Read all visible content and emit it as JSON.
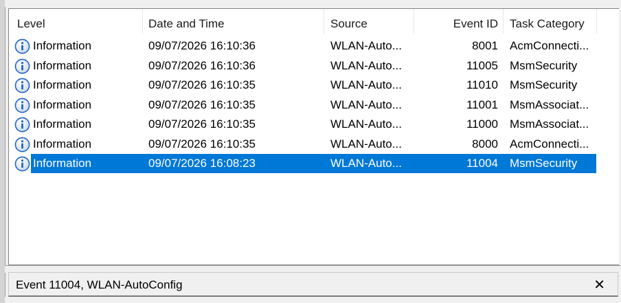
{
  "columns": {
    "level": "Level",
    "date": "Date and Time",
    "source": "Source",
    "event_id": "Event ID",
    "task": "Task Category"
  },
  "rows": [
    {
      "level": "Information",
      "date": "09/07/2026 16:10:36",
      "source": "WLAN-Auto...",
      "event_id": "8001",
      "task": "AcmConnecti..."
    },
    {
      "level": "Information",
      "date": "09/07/2026 16:10:36",
      "source": "WLAN-Auto...",
      "event_id": "11005",
      "task": "MsmSecurity"
    },
    {
      "level": "Information",
      "date": "09/07/2026 16:10:35",
      "source": "WLAN-Auto...",
      "event_id": "11010",
      "task": "MsmSecurity"
    },
    {
      "level": "Information",
      "date": "09/07/2026 16:10:35",
      "source": "WLAN-Auto...",
      "event_id": "11001",
      "task": "MsmAssociat..."
    },
    {
      "level": "Information",
      "date": "09/07/2026 16:10:35",
      "source": "WLAN-Auto...",
      "event_id": "11000",
      "task": "MsmAssociat..."
    },
    {
      "level": "Information",
      "date": "09/07/2026 16:10:35",
      "source": "WLAN-Auto...",
      "event_id": "8000",
      "task": "AcmConnecti..."
    },
    {
      "level": "Information",
      "date": "09/07/2026 16:08:23",
      "source": "WLAN-Auto...",
      "event_id": "11004",
      "task": "MsmSecurity",
      "selected": true
    }
  ],
  "detail": {
    "title": "Event 11004, WLAN-AutoConfig",
    "close_glyph": "✕"
  },
  "icons": {
    "row_icon": "info-icon",
    "close": "close-icon"
  },
  "colors": {
    "selection": "#0078d7",
    "info_icon": "#1e5fbf"
  }
}
